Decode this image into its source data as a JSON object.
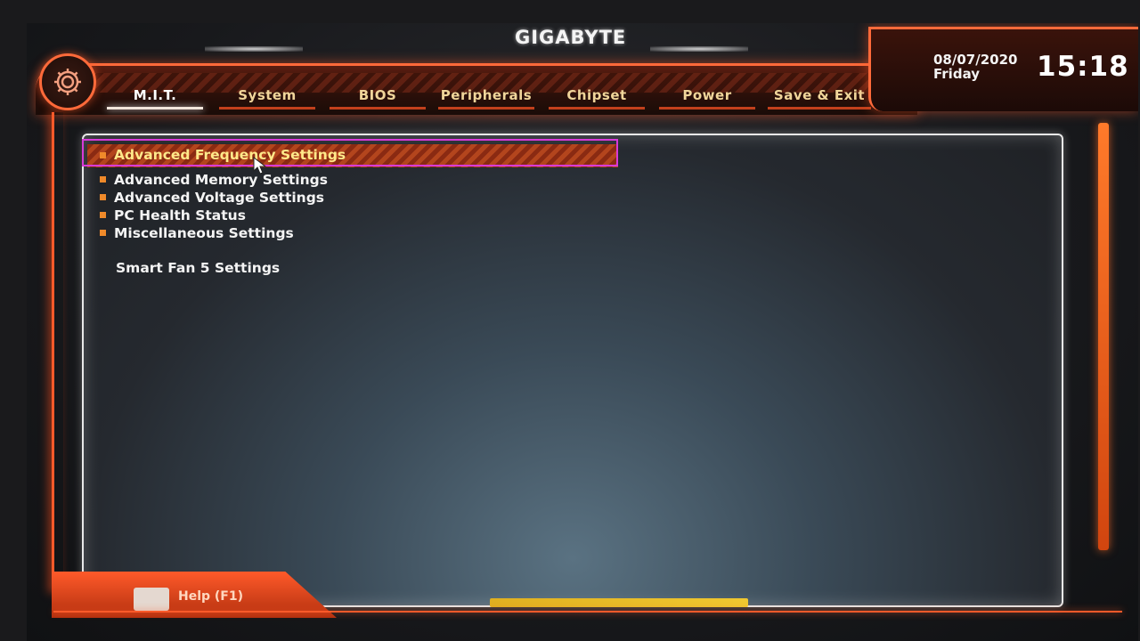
{
  "brand": {
    "logo": "GIGABYTE"
  },
  "datetime": {
    "date": "08/07/2020",
    "day": "Friday",
    "time": "15:18"
  },
  "tabs": [
    {
      "label": "M.I.T.",
      "active": true
    },
    {
      "label": "System",
      "active": false
    },
    {
      "label": "BIOS",
      "active": false
    },
    {
      "label": "Peripherals",
      "active": false
    },
    {
      "label": "Chipset",
      "active": false
    },
    {
      "label": "Power",
      "active": false
    },
    {
      "label": "Save & Exit",
      "active": false
    }
  ],
  "menu": {
    "items": [
      {
        "label": "Advanced Frequency Settings",
        "selected": true
      },
      {
        "label": "Advanced Memory Settings",
        "selected": false
      },
      {
        "label": "Advanced Voltage Settings",
        "selected": false
      },
      {
        "label": "PC Health Status",
        "selected": false
      },
      {
        "label": "Miscellaneous Settings",
        "selected": false
      }
    ],
    "extra_item": "Smart Fan 5 Settings"
  },
  "footer": {
    "help_label": "Help (F1)"
  },
  "colors": {
    "accent": "#ff5a2a",
    "tab_text": "#f0d59a",
    "selected_text": "#ffe98a",
    "bullet": "#f08a2a",
    "highlight_box": "#d83ad8"
  },
  "icons": [
    "gear-icon",
    "pointer-cursor-icon"
  ]
}
